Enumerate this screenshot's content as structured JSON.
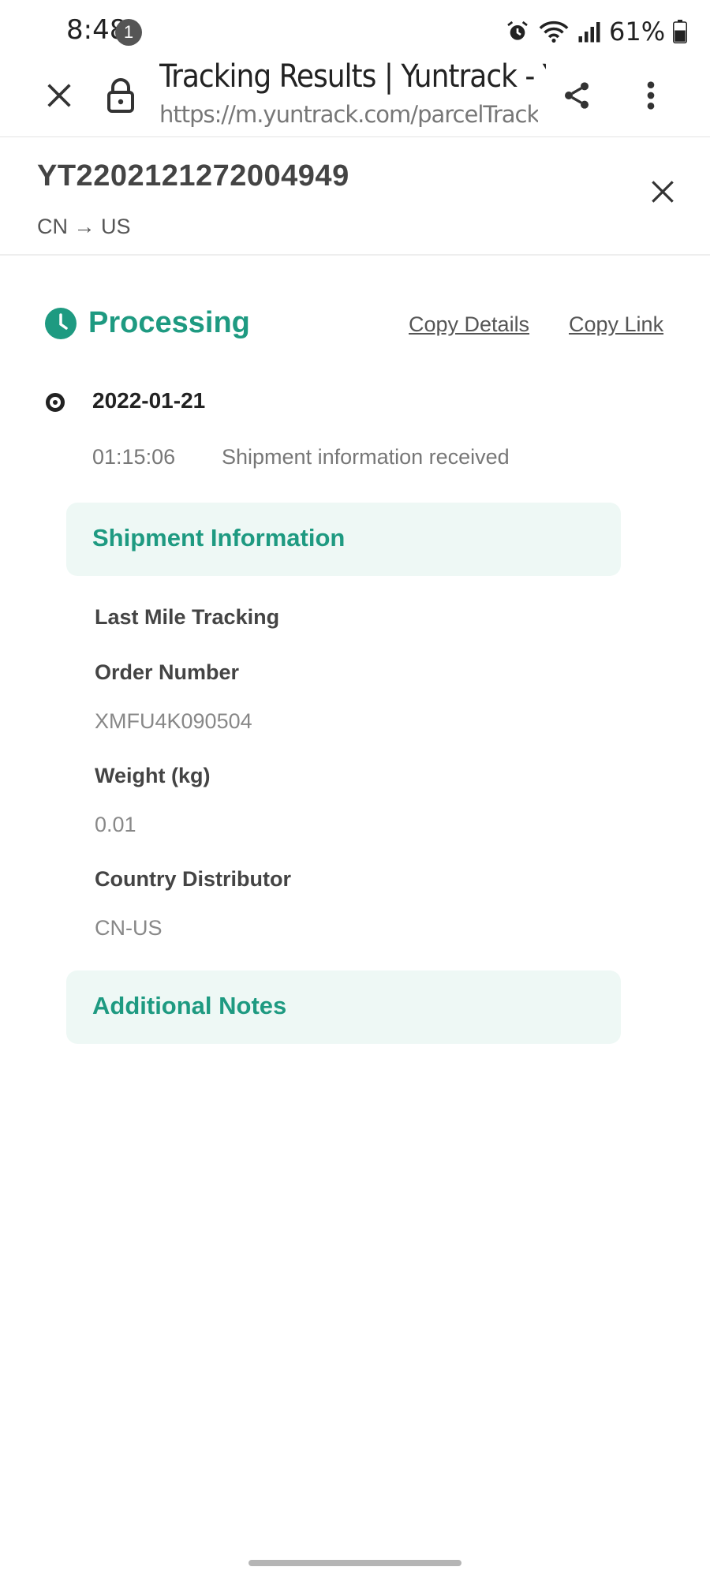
{
  "status_bar": {
    "time": "8:48",
    "notification_count": "1",
    "battery": "61%",
    "icons": [
      "alarm-icon",
      "wifi-icon",
      "signal-icon",
      "battery-icon"
    ]
  },
  "browser": {
    "page_title": "Tracking Results | Yuntrack - Yu...",
    "url": "https://m.yuntrack.com/parcelTracking?id=..."
  },
  "tracking": {
    "number": "YT2202121272004949",
    "route": "CN → US",
    "status": "Processing",
    "copy_details": "Copy Details",
    "copy_link": "Copy Link"
  },
  "events": [
    {
      "date": "2022-01-21",
      "time": "01:15:06",
      "description": "Shipment information received"
    }
  ],
  "shipment_info": {
    "title": "Shipment Information",
    "fields": [
      {
        "label": "Last Mile Tracking",
        "value": ""
      },
      {
        "label": "Order Number",
        "value": "XMFU4K090504"
      },
      {
        "label": "Weight (kg)",
        "value": "0.01"
      },
      {
        "label": "Country Distributor",
        "value": "CN-US"
      }
    ]
  },
  "additional_notes": {
    "title": "Additional Notes"
  },
  "colors": {
    "accent": "#1e9a81",
    "panel_bg": "#eef8f5"
  }
}
